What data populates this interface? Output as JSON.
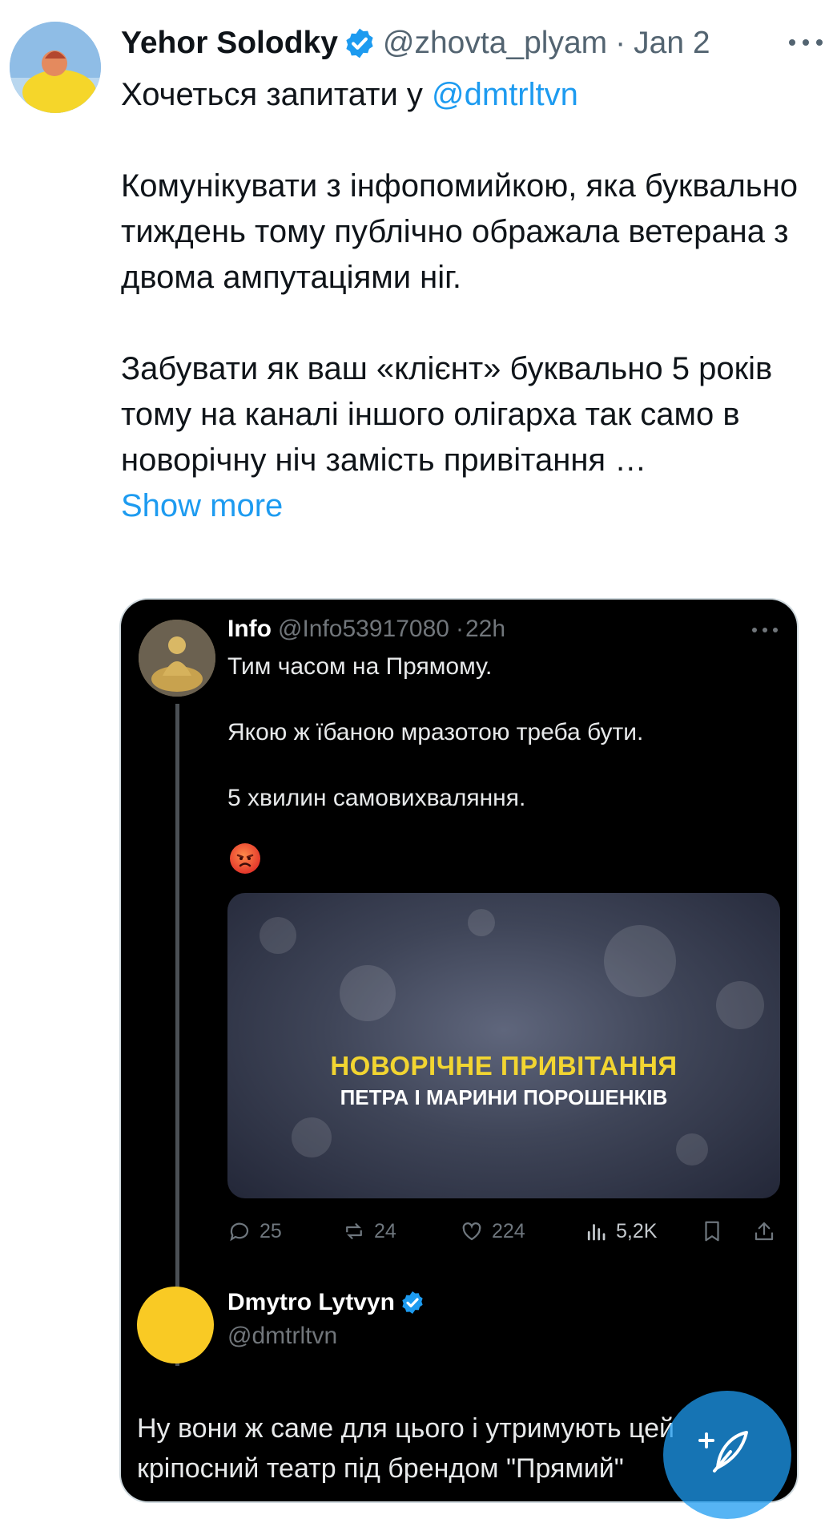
{
  "tweet": {
    "author_name": "Yehor Solodky",
    "author_handle": "@zhovta_plyam",
    "date": "Jan 2",
    "text_intro": "Хочеться запитати у ",
    "mention": "@dmtrltvn",
    "text_body": "\n\nКомунікувати з інфопомийкою, яка буквально тиждень тому публічно ображала ветерана з двома ампутаціями ніг.\n\nЗабувати як ваш «клієнт» буквально 5 років тому на каналі іншого олігарха так само в новорічну ніч замість привітання …",
    "show_more": "Show more"
  },
  "quoted": {
    "author_name": "Info",
    "author_handle": "@Info53917080",
    "time": "22h",
    "text": "Тим часом на Прямому.\n\nЯкою ж їбаною мразотою треба бути.\n\n5 хвилин самовихваляння.",
    "media_title": "НОВОРІЧНЕ ПРИВІТАННЯ",
    "media_subtitle": "ПЕТРА І МАРИНИ ПОРОШЕНКІВ",
    "stats": {
      "replies": "25",
      "reposts": "24",
      "likes": "224",
      "views": "5,2K"
    }
  },
  "reply": {
    "author_name": "Dmytro Lytvyn",
    "author_handle": "@dmtrltvn",
    "text": "Ну вони ж саме для цього і утримують цей кріпосний театр під брендом \"Прямий\""
  },
  "colors": {
    "accent": "#1d9bf0",
    "text_primary": "#0f1419",
    "text_secondary": "#536471",
    "card_background": "#000000",
    "media_title_yellow": "#f2d531"
  }
}
